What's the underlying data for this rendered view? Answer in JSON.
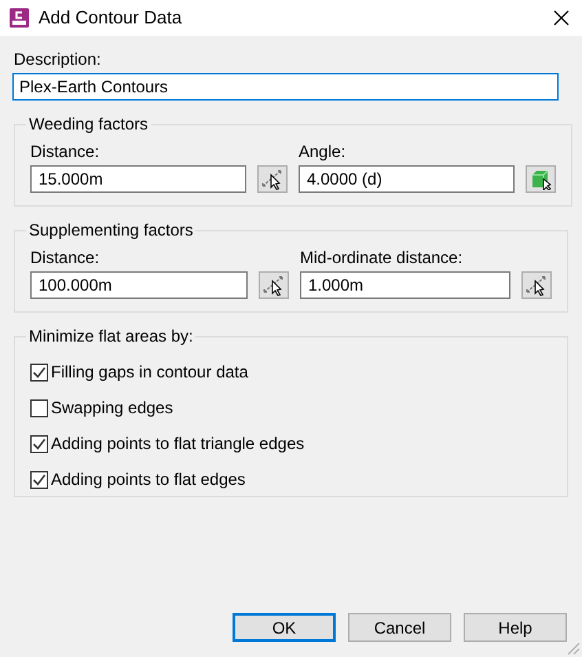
{
  "window": {
    "title": "Add Contour Data"
  },
  "description": {
    "label": "Description:",
    "value": "Plex-Earth Contours"
  },
  "groups": [
    {
      "title": "Weeding factors",
      "fields": [
        {
          "label": "Distance:",
          "value": "15.000m",
          "kind": "distance"
        },
        {
          "label": "Angle:",
          "value": "4.0000 (d)",
          "kind": "angle"
        }
      ]
    },
    {
      "title": "Supplementing factors",
      "fields": [
        {
          "label": "Distance:",
          "value": "100.000m",
          "kind": "distance"
        },
        {
          "label": "Mid-ordinate distance:",
          "value": "1.000m",
          "kind": "distance"
        }
      ]
    }
  ],
  "minimize": {
    "title": "Minimize flat areas by:",
    "options": [
      {
        "label": "Filling gaps in contour data",
        "checked": true
      },
      {
        "label": "Swapping edges",
        "checked": false
      },
      {
        "label": "Adding points to flat triangle edges",
        "checked": true
      },
      {
        "label": "Adding points to flat edges",
        "checked": true
      }
    ]
  },
  "buttons": [
    {
      "label": "OK",
      "default": true
    },
    {
      "label": "Cancel",
      "default": false
    },
    {
      "label": "Help",
      "default": false
    }
  ]
}
